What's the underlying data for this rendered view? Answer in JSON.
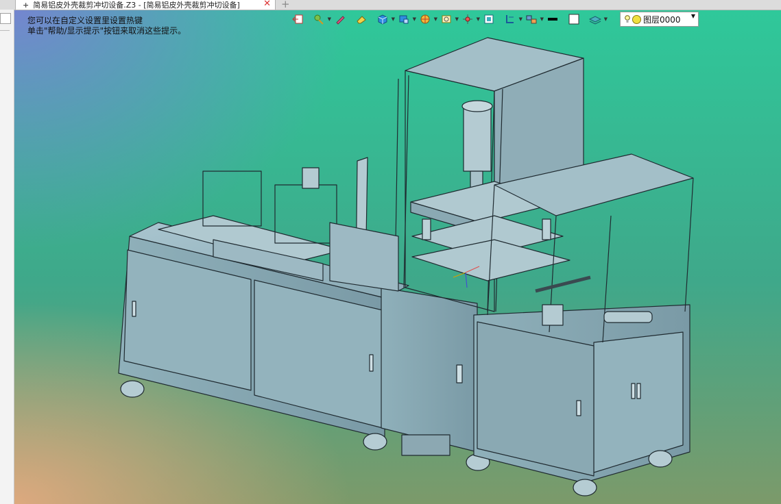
{
  "tab": {
    "title": "简易铝皮外壳裁剪冲切设备.Z3 - [简易铝皮外壳裁剪冲切设备]",
    "plus_glyph": "+",
    "close_glyph": "✕",
    "new_tab_glyph": "+"
  },
  "viewport": {
    "hint_line1": "您可以在自定义设置里设置热键",
    "hint_line2": "单击\"帮助/显示提示\"按钮来取消这些提示。"
  },
  "toolbar": {
    "icons": [
      "exit-sketch-icon",
      "pick-filter-icon",
      "edit-pencil-icon",
      "eraser-icon",
      "shade-cube-icon",
      "view-cube-icon",
      "render-mode-icon",
      "zoom-view-icon",
      "axis-orient-icon",
      "frame-view-icon",
      "section-icon",
      "layout-icon",
      "line-color-icon",
      "fill-color-icon",
      "layer-stack-icon"
    ],
    "layer_name": "图层0000",
    "colors": {
      "line": "#000000",
      "fill": "#ffffff"
    }
  }
}
